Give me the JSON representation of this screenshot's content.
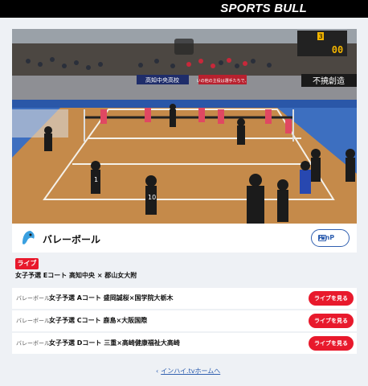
{
  "header": {
    "brand": "SPORTS BULL"
  },
  "video": {
    "scoreboard_set": "3",
    "scoreboard_score": "00",
    "banners": [
      "高知中央高校",
      "いの他の主役は選手たちで、",
      "不撓創造"
    ]
  },
  "channel": {
    "title": "バレーボール",
    "pinp_label": "PinP",
    "live_badge": "ライブ",
    "current_match": "女子予選 Eコート 高知中央 × 郡山女大附"
  },
  "matches": [
    {
      "category": "バレーボール",
      "title": "女子予選 Aコート 盛岡誠桜×国学院大栃木",
      "button": "ライブを見る"
    },
    {
      "category": "バレーボール",
      "title": "女子予選 Cコート 鹿島×大阪国際",
      "button": "ライブを見る"
    },
    {
      "category": "バレーボール",
      "title": "女子予選 Dコート 三重×高崎健康福祉大高崎",
      "button": "ライブを見る"
    }
  ],
  "footer": {
    "home_link": "インハイ.tvホームへ"
  },
  "colors": {
    "accent_red": "#e8192c",
    "link_blue": "#2f5fb0",
    "court": "#c58a4a"
  }
}
